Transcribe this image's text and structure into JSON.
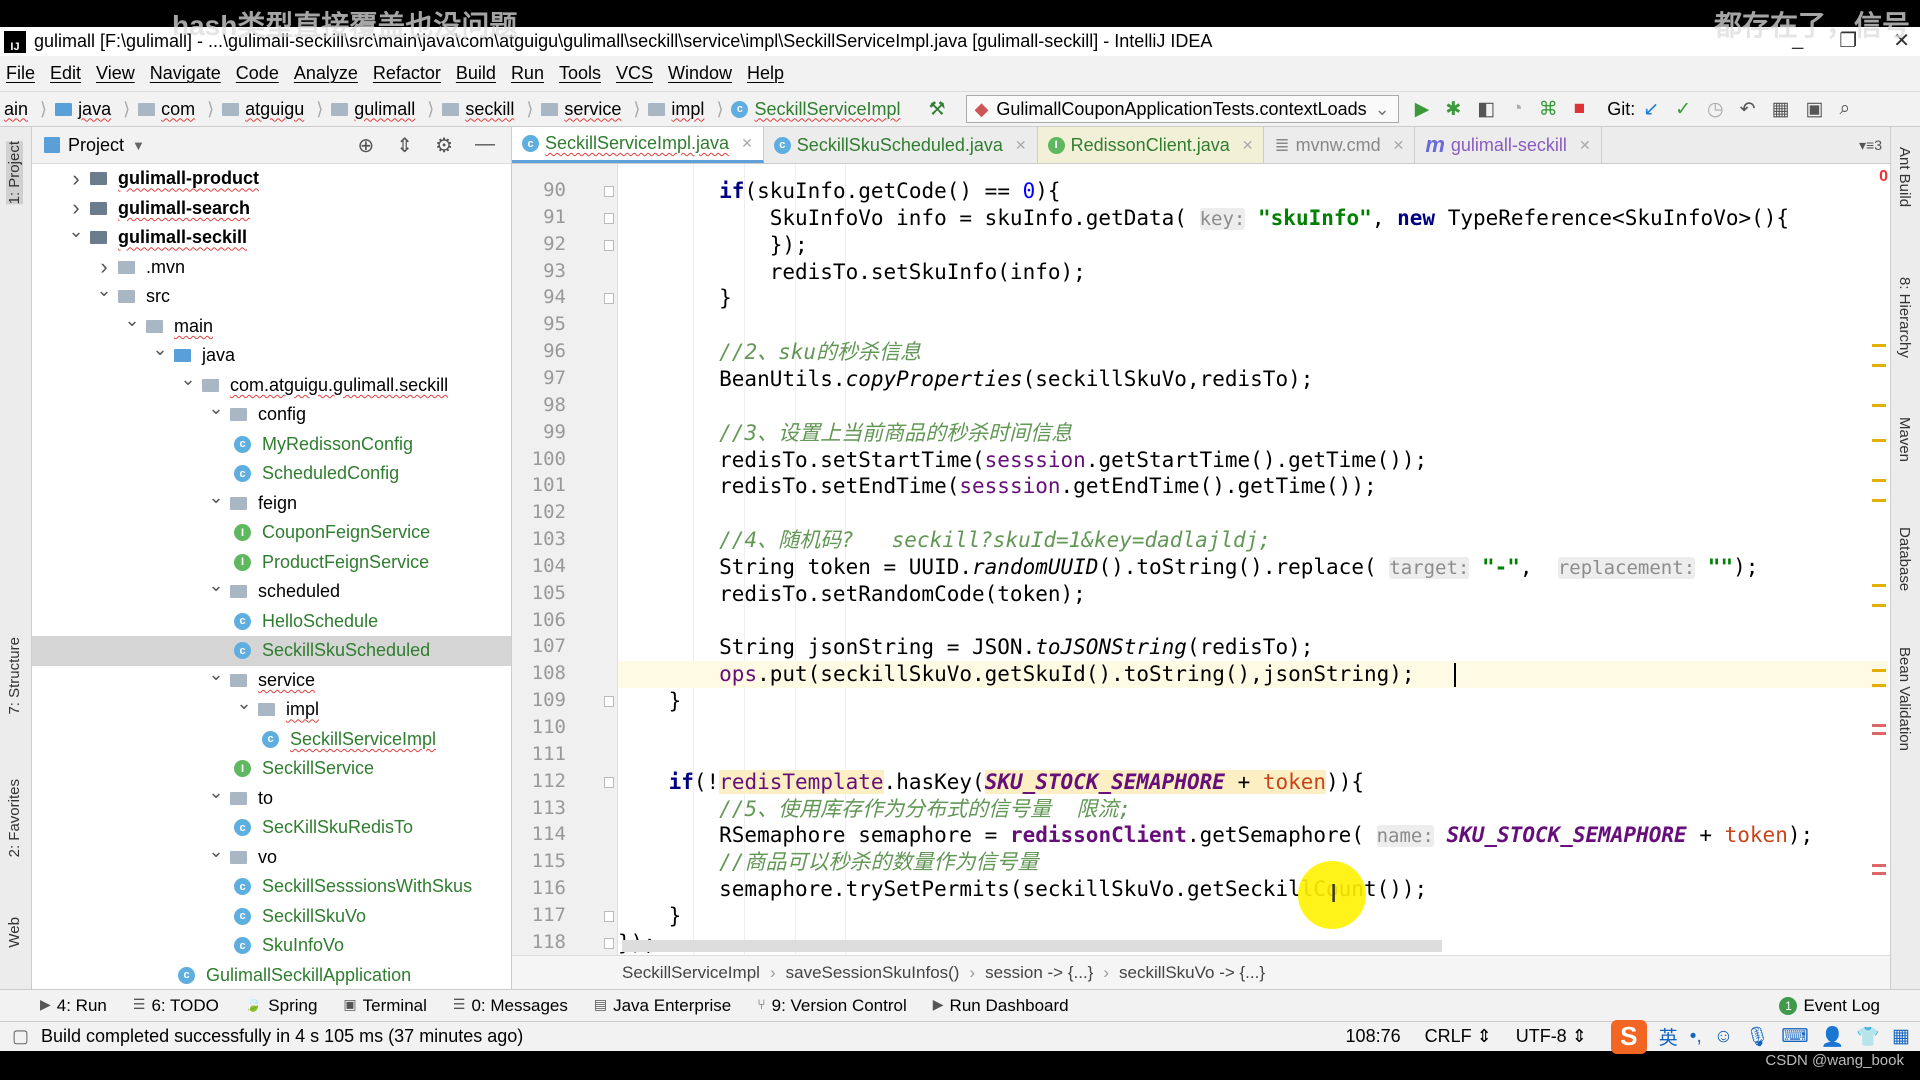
{
  "subtitles": {
    "left": "hash类型直接覆盖也没问题",
    "right": "都存在了，信号"
  },
  "window": {
    "title": "gulimall [F:\\gulimall] - ...\\gulimall-seckill\\src\\main\\java\\com\\atguigu\\gulimall\\seckill\\service\\impl\\SeckillServiceImpl.java [gulimall-seckill] - IntelliJ IDEA",
    "minimize": "_",
    "restore": "❐",
    "close": "✕"
  },
  "menu": [
    "File",
    "Edit",
    "View",
    "Navigate",
    "Code",
    "Analyze",
    "Refactor",
    "Build",
    "Run",
    "Tools",
    "VCS",
    "Window",
    "Help"
  ],
  "nav": {
    "crumbs": [
      "ain",
      "java",
      "com",
      "atguigu",
      "gulimall",
      "seckill",
      "service",
      "impl"
    ],
    "file": "SeckillServiceImpl",
    "run_config": "GulimallCouponApplicationTests.contextLoads",
    "git_label": "Git:"
  },
  "project": {
    "title": "Project",
    "tree": [
      {
        "d": 0,
        "a": "right",
        "i": "module",
        "t": "gulimall-product",
        "b": true
      },
      {
        "d": 0,
        "a": "right",
        "i": "module",
        "t": "gulimall-search",
        "b": true
      },
      {
        "d": 0,
        "a": "down",
        "i": "module",
        "t": "gulimall-seckill",
        "b": true
      },
      {
        "d": 1,
        "a": "right",
        "i": "folder",
        "t": ".mvn"
      },
      {
        "d": 1,
        "a": "down",
        "i": "folder",
        "t": "src"
      },
      {
        "d": 2,
        "a": "down",
        "i": "folder",
        "t": "main"
      },
      {
        "d": 3,
        "a": "down",
        "i": "bluefolder",
        "t": "java"
      },
      {
        "d": 4,
        "a": "down",
        "i": "folder",
        "t": "com.atguigu.gulimall.seckill"
      },
      {
        "d": 5,
        "a": "down",
        "i": "folder",
        "t": "config"
      },
      {
        "d": 6,
        "i": "class",
        "t": "MyRedissonConfig",
        "g": true
      },
      {
        "d": 6,
        "i": "class",
        "t": "ScheduledConfig",
        "g": true
      },
      {
        "d": 5,
        "a": "down",
        "i": "folder",
        "t": "feign"
      },
      {
        "d": 6,
        "i": "interface",
        "t": "CouponFeignService",
        "g": true
      },
      {
        "d": 6,
        "i": "interface",
        "t": "ProductFeignService",
        "g": true
      },
      {
        "d": 5,
        "a": "down",
        "i": "folder",
        "t": "scheduled"
      },
      {
        "d": 6,
        "i": "class",
        "t": "HelloSchedule",
        "g": true
      },
      {
        "d": 6,
        "i": "class",
        "t": "SeckillSkuScheduled",
        "g": true,
        "sel": true
      },
      {
        "d": 5,
        "a": "down",
        "i": "folder",
        "t": "service"
      },
      {
        "d": 6,
        "a": "down",
        "i": "folder",
        "t": "impl"
      },
      {
        "d": 7,
        "i": "class",
        "t": "SeckillServiceImpl",
        "g": true
      },
      {
        "d": 6,
        "i": "interface",
        "t": "SeckillService",
        "g": true
      },
      {
        "d": 5,
        "a": "down",
        "i": "folder",
        "t": "to"
      },
      {
        "d": 6,
        "i": "class",
        "t": "SecKillSkuRedisTo",
        "g": true
      },
      {
        "d": 5,
        "a": "down",
        "i": "folder",
        "t": "vo"
      },
      {
        "d": 6,
        "i": "class",
        "t": "SeckillSesssionsWithSkus",
        "g": true
      },
      {
        "d": 6,
        "i": "class",
        "t": "SeckillSkuVo",
        "g": true
      },
      {
        "d": 6,
        "i": "class",
        "t": "SkuInfoVo",
        "g": true
      },
      {
        "d": 4,
        "i": "class",
        "t": "GulimallSeckillApplication",
        "g": true
      }
    ]
  },
  "tabs": [
    {
      "label": "SeckillServiceImpl.java",
      "icon": "class",
      "active": true
    },
    {
      "label": "SeckillSkuScheduled.java",
      "icon": "class"
    },
    {
      "label": "RedissonClient.java",
      "icon": "interface"
    },
    {
      "label": "mvnw.cmd",
      "icon": "file"
    },
    {
      "label": "gulimall-seckill",
      "icon": "maven"
    }
  ],
  "tabs_overflow": "▾≡3",
  "editor": {
    "error_count": "0",
    "cursor_line": 108,
    "lines": [
      {
        "n": "90",
        "c": [
          [
            "        ",
            ""
          ],
          [
            "if",
            "kw"
          ],
          [
            "(skuInfo.getCode() == ",
            ""
          ],
          [
            "0",
            "num"
          ],
          [
            "){",
            ""
          ]
        ]
      },
      {
        "n": "91",
        "c": [
          [
            "            SkuInfoVo info = skuInfo.getData( ",
            ""
          ],
          [
            "key:",
            "hint"
          ],
          [
            " ",
            ""
          ],
          [
            "\"skuInfo\"",
            "str"
          ],
          [
            ", ",
            ""
          ],
          [
            "new",
            "kw"
          ],
          [
            " TypeReference<SkuInfoVo>(){",
            ""
          ]
        ]
      },
      {
        "n": "92",
        "c": [
          [
            "            });",
            ""
          ]
        ]
      },
      {
        "n": "93",
        "c": [
          [
            "            redisTo.setSkuInfo(info);",
            ""
          ]
        ]
      },
      {
        "n": "94",
        "c": [
          [
            "        }",
            ""
          ]
        ]
      },
      {
        "n": "95",
        "c": []
      },
      {
        "n": "96",
        "c": [
          [
            "        ",
            ""
          ],
          [
            "//2、sku的秒杀信息",
            "cm"
          ]
        ]
      },
      {
        "n": "97",
        "c": [
          [
            "        BeanUtils.",
            ""
          ],
          [
            "copyProperties",
            "st"
          ],
          [
            "(seckillSkuVo,redisTo);",
            ""
          ]
        ]
      },
      {
        "n": "98",
        "c": []
      },
      {
        "n": "99",
        "c": [
          [
            "        ",
            ""
          ],
          [
            "//3、设置上当前商品的秒杀时间信息",
            "cm"
          ]
        ]
      },
      {
        "n": "100",
        "c": [
          [
            "        redisTo.setStartTime(",
            ""
          ],
          [
            "sesssion",
            "fld"
          ],
          [
            ".getStartTime().getTime());",
            ""
          ]
        ]
      },
      {
        "n": "101",
        "c": [
          [
            "        redisTo.setEndTime(",
            ""
          ],
          [
            "sesssion",
            "fld"
          ],
          [
            ".getEndTime().getTime());",
            ""
          ]
        ]
      },
      {
        "n": "102",
        "c": []
      },
      {
        "n": "103",
        "c": [
          [
            "        ",
            ""
          ],
          [
            "//4、随机码?   seckill?skuId=1&key=dadlajldj;",
            "cm"
          ]
        ]
      },
      {
        "n": "104",
        "c": [
          [
            "        String token = UUID.",
            ""
          ],
          [
            "randomUUID",
            "st"
          ],
          [
            "().toString().replace( ",
            ""
          ],
          [
            "target:",
            "hint"
          ],
          [
            " ",
            ""
          ],
          [
            "\"-\"",
            "str"
          ],
          [
            ",  ",
            ""
          ],
          [
            "replacement:",
            "hint"
          ],
          [
            " ",
            ""
          ],
          [
            "\"\"",
            "str"
          ],
          [
            ");",
            ""
          ]
        ]
      },
      {
        "n": "105",
        "c": [
          [
            "        redisTo.setRandomCode(token);",
            ""
          ]
        ]
      },
      {
        "n": "106",
        "c": []
      },
      {
        "n": "107",
        "c": [
          [
            "        String jsonString = JSON.",
            ""
          ],
          [
            "toJSONString",
            "st"
          ],
          [
            "(redisTo);",
            ""
          ]
        ]
      },
      {
        "n": "108",
        "c": [
          [
            "        ",
            ""
          ],
          [
            "ops",
            "fld"
          ],
          [
            ".put(seckillSkuVo.getSkuId().toString(),jsonString);",
            ""
          ]
        ]
      },
      {
        "n": "109",
        "c": [
          [
            "    }",
            ""
          ]
        ]
      },
      {
        "n": "110",
        "c": []
      },
      {
        "n": "111",
        "c": []
      },
      {
        "n": "112",
        "c": [
          [
            "    ",
            ""
          ],
          [
            "if",
            "kw"
          ],
          [
            "(!",
            ""
          ],
          [
            "redisTemplate",
            "fld hl"
          ],
          [
            ".hasKey(",
            ""
          ],
          [
            "SKU_STOCK_SEMAPHORE",
            "const hl"
          ],
          [
            " + ",
            "hl"
          ],
          [
            "token",
            "red hl"
          ],
          [
            ")){",
            ""
          ]
        ]
      },
      {
        "n": "113",
        "c": [
          [
            "        ",
            ""
          ],
          [
            "//5、使用库存作为分布式的信号量  限流;",
            "cm"
          ]
        ]
      },
      {
        "n": "114",
        "c": [
          [
            "        RSemaphore semaphore = ",
            ""
          ],
          [
            "redissonClient",
            "fld kwb"
          ],
          [
            ".getSemaphore( ",
            ""
          ],
          [
            "name:",
            "hint"
          ],
          [
            " ",
            ""
          ],
          [
            "SKU_STOCK_SEMAPHORE",
            "const"
          ],
          [
            " + ",
            ""
          ],
          [
            "token",
            "red"
          ],
          [
            ");",
            ""
          ]
        ]
      },
      {
        "n": "115",
        "c": [
          [
            "        ",
            ""
          ],
          [
            "//商品可以秒杀的数量作为信号量",
            "cm"
          ]
        ]
      },
      {
        "n": "116",
        "c": [
          [
            "        semaphore.trySetPermits(seckillSkuVo.getSeckillCount());",
            ""
          ]
        ]
      },
      {
        "n": "117",
        "c": [
          [
            "    }",
            ""
          ]
        ]
      },
      {
        "n": "118",
        "c": [
          [
            "});",
            ""
          ]
        ]
      }
    ]
  },
  "editor_breadcrumb": [
    "SeckillServiceImpl",
    "saveSessionSkuInfos()",
    "session -> {...}",
    "seckillSkuVo -> {...}"
  ],
  "left_tools": [
    "1: Project",
    "7: Structure",
    "2: Favorites",
    "Web"
  ],
  "right_tools": [
    "Ant Build",
    "8: Hierarchy",
    "Maven",
    "Database",
    "Bean Validation"
  ],
  "bottom_tools": [
    "4: Run",
    "6: TODO",
    "Spring",
    "Terminal",
    "0: Messages",
    "Java Enterprise",
    "9: Version Control",
    "Run Dashboard"
  ],
  "event_log": {
    "count": "1",
    "label": "Event Log"
  },
  "status": {
    "message": "Build completed successfully in 4 s 105 ms (37 minutes ago)",
    "position": "108:76",
    "line_sep": "CRLF ⇕",
    "encoding": "UTF-8 ⇕"
  },
  "ime": {
    "logo": "S",
    "lang": "英",
    "punct": "•,"
  },
  "watermark": "CSDN @wang_book"
}
